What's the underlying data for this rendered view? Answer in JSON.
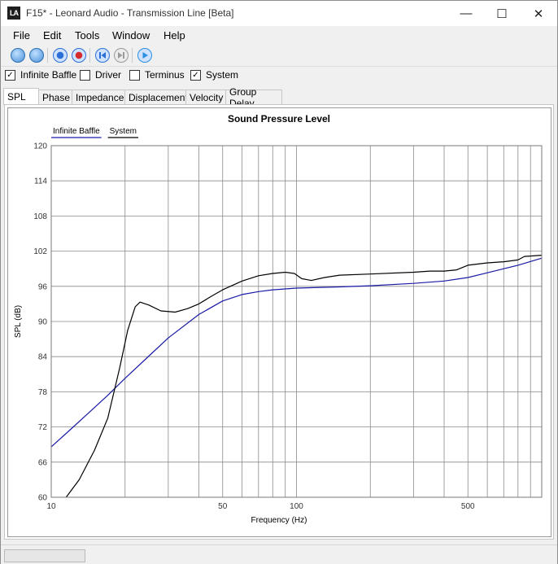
{
  "window": {
    "title": "F15* - Leonard Audio - Transmission Line [Beta]",
    "icon_text": "LA"
  },
  "window_controls": {
    "minimize": "—",
    "maximize": "☐",
    "close": "✕"
  },
  "menu": {
    "file": "File",
    "edit": "Edit",
    "tools": "Tools",
    "window": "Window",
    "help": "Help"
  },
  "toolbar": {
    "buttons": [
      {
        "name": "new-icon",
        "color": "#4a90d9"
      },
      {
        "name": "open-icon",
        "color": "#4a90d9"
      },
      {
        "name": "record-blue-icon",
        "color": "#2b6fd6"
      },
      {
        "name": "record-red-icon",
        "color": "#d62b2b"
      },
      {
        "name": "step-back-icon",
        "color": "#2b6fd6"
      },
      {
        "name": "step-forward-icon",
        "color": "#9a9a9a"
      },
      {
        "name": "play-icon",
        "color": "#2b8fe0"
      }
    ]
  },
  "options": {
    "infinite_baffle": {
      "label": "Infinite Baffle",
      "checked": true
    },
    "driver": {
      "label": "Driver",
      "checked": false
    },
    "terminus": {
      "label": "Terminus",
      "checked": false
    },
    "system": {
      "label": "System",
      "checked": true
    }
  },
  "tabs": {
    "spl": "SPL",
    "phase": "Phase",
    "impedance": "Impedance",
    "displacement": "Displacement",
    "velocity": "Velocity",
    "group_delay": "Group Delay",
    "active": "SPL"
  },
  "chart_data": {
    "type": "line",
    "title": "Sound Pressure Level",
    "xlabel": "Frequency (Hz)",
    "ylabel": "SPL (dB)",
    "x_scale": "log",
    "xlim": [
      10,
      1000
    ],
    "ylim": [
      60,
      120
    ],
    "x_tick_labels": [
      "10",
      "50",
      "100",
      "500"
    ],
    "x_tick_values": [
      10,
      50,
      100,
      500
    ],
    "y_ticks": [
      60,
      66,
      72,
      78,
      84,
      90,
      96,
      102,
      108,
      114,
      120
    ],
    "grid": true,
    "legend_position": "top-left",
    "series": [
      {
        "name": "Infinite Baffle",
        "color": "#1a1aa6",
        "x": [
          10,
          12,
          15,
          17,
          20,
          25,
          30,
          40,
          50,
          60,
          70,
          80,
          100,
          150,
          200,
          300,
          400,
          500,
          600,
          700,
          800,
          1000
        ],
        "y": [
          68.6,
          71.6,
          75.3,
          77.4,
          80.3,
          84.1,
          87.2,
          91.2,
          93.5,
          94.6,
          95.1,
          95.4,
          95.7,
          95.9,
          96.1,
          96.5,
          96.9,
          97.5,
          98.3,
          99.0,
          99.6,
          100.8
        ]
      },
      {
        "name": "System",
        "color": "#000000",
        "x": [
          11.5,
          13,
          15,
          17,
          19,
          20.5,
          22,
          23,
          25,
          28,
          32,
          36,
          40,
          45,
          50,
          60,
          70,
          80,
          90,
          98,
          105,
          115,
          130,
          150,
          200,
          300,
          350,
          400,
          450,
          500,
          550,
          600,
          700,
          800,
          850,
          1000
        ],
        "y": [
          60,
          63,
          68,
          73.5,
          82,
          88.5,
          92.5,
          93.3,
          92.8,
          91.8,
          91.6,
          92.2,
          93,
          94.3,
          95.4,
          96.9,
          97.8,
          98.2,
          98.4,
          98.2,
          97.3,
          97,
          97.5,
          97.9,
          98.1,
          98.4,
          98.6,
          98.6,
          98.8,
          99.6,
          99.8,
          100,
          100.2,
          100.5,
          101.1,
          101.3
        ]
      }
    ]
  }
}
